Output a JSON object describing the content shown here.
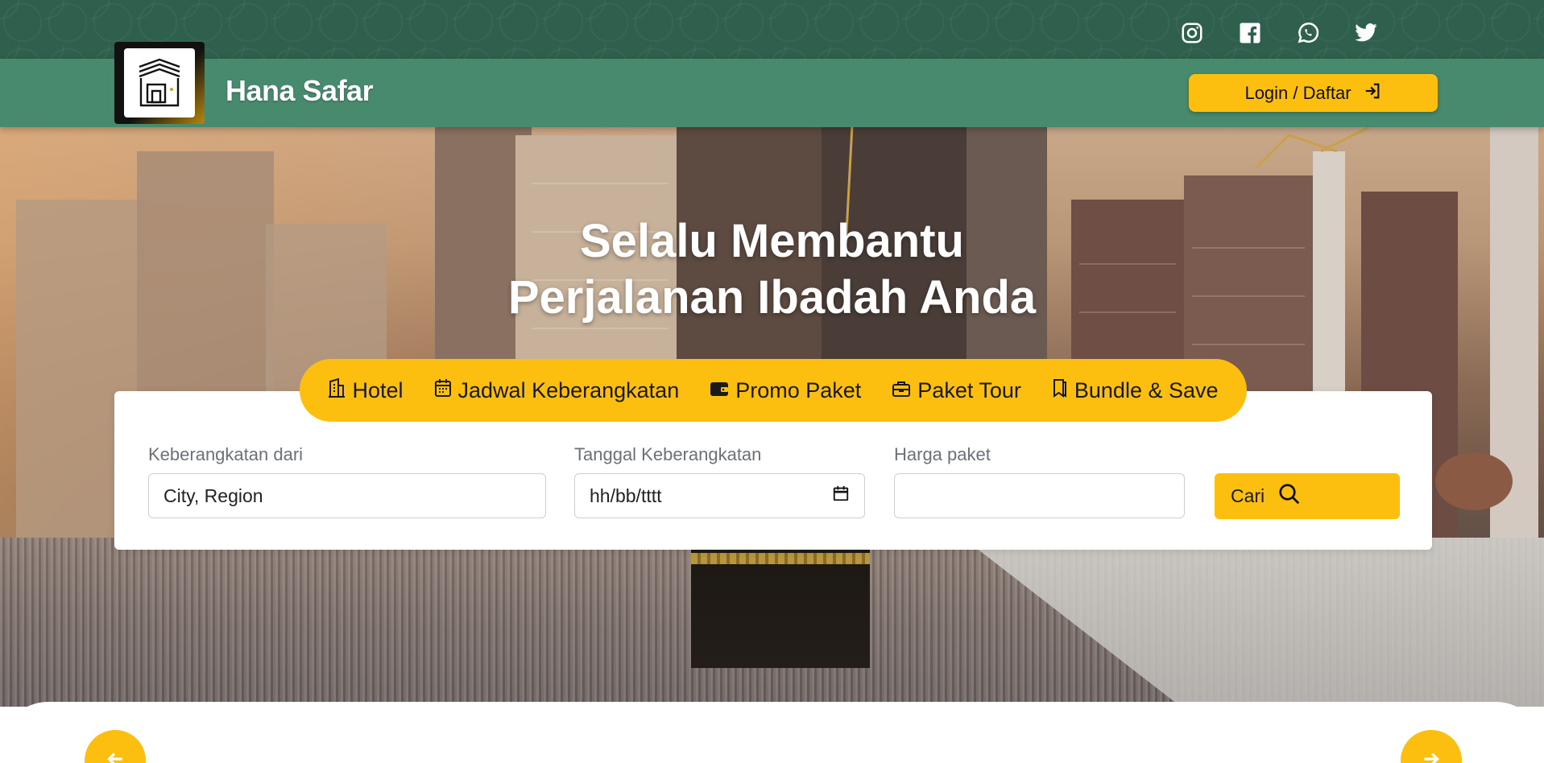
{
  "social": [
    {
      "name": "instagram-icon"
    },
    {
      "name": "facebook-icon"
    },
    {
      "name": "whatsapp-icon"
    },
    {
      "name": "twitter-icon"
    }
  ],
  "header": {
    "brand": "Hana Safar",
    "login_label": "Login / Daftar"
  },
  "hero": {
    "title_line1": "Selalu Membantu",
    "title_line2": "Perjalanan Ibadah Anda"
  },
  "tabs": [
    {
      "label": "Hotel",
      "icon": "hotel-icon"
    },
    {
      "label": "Jadwal Keberangkatan",
      "icon": "calendar-icon"
    },
    {
      "label": "Promo Paket",
      "icon": "wallet-icon"
    },
    {
      "label": "Paket Tour",
      "icon": "briefcase-icon"
    },
    {
      "label": "Bundle & Save",
      "icon": "bookmark-icon"
    }
  ],
  "search": {
    "departure_label": "Keberangkatan dari",
    "departure_value": "City, Region",
    "date_label": "Tanggal Keberangkatan",
    "date_value": "hh/bb/tttt",
    "price_label": "Harga paket",
    "price_value": "",
    "submit_label": "Cari"
  },
  "colors": {
    "accent": "#fcbf0f",
    "header_green": "#478a6e",
    "topbar_green": "#2f5f4d"
  }
}
